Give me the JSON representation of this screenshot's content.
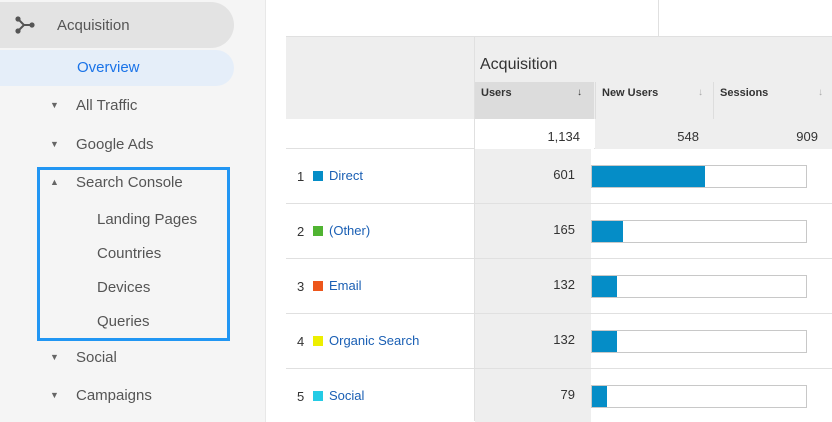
{
  "sidebar": {
    "section_label": "Acquisition",
    "overview_label": "Overview",
    "items": [
      {
        "label": "All Traffic",
        "arrow": "▼"
      },
      {
        "label": "Google Ads",
        "arrow": "▼"
      },
      {
        "label": "Search Console",
        "arrow": "▲"
      },
      {
        "label": "Social",
        "arrow": "▼"
      },
      {
        "label": "Campaigns",
        "arrow": "▼"
      }
    ],
    "search_console_subitems": [
      {
        "label": "Landing Pages"
      },
      {
        "label": "Countries"
      },
      {
        "label": "Devices"
      },
      {
        "label": "Queries"
      }
    ],
    "highlight_color": "#2196f3"
  },
  "table": {
    "group_title": "Acquisition",
    "columns": [
      {
        "label": "Users",
        "sort": "↓"
      },
      {
        "label": "New Users",
        "sort": "↓"
      },
      {
        "label": "Sessions",
        "sort": "↓"
      }
    ],
    "totals": {
      "users": "1,134",
      "new_users": "548",
      "sessions": "909"
    },
    "rows": [
      {
        "num": "1",
        "channel": "Direct",
        "users": "601",
        "color": "#058dc7",
        "share": 0.53
      },
      {
        "num": "2",
        "channel": "(Other)",
        "users": "165",
        "color": "#50b432",
        "share": 0.146
      },
      {
        "num": "3",
        "channel": "Email",
        "users": "132",
        "color": "#ed561b",
        "share": 0.116
      },
      {
        "num": "4",
        "channel": "Organic Search",
        "users": "132",
        "color": "#edef00",
        "share": 0.116
      },
      {
        "num": "5",
        "channel": "Social",
        "users": "79",
        "color": "#24cbe5",
        "share": 0.07
      }
    ],
    "bar_color": "#058dc7"
  }
}
